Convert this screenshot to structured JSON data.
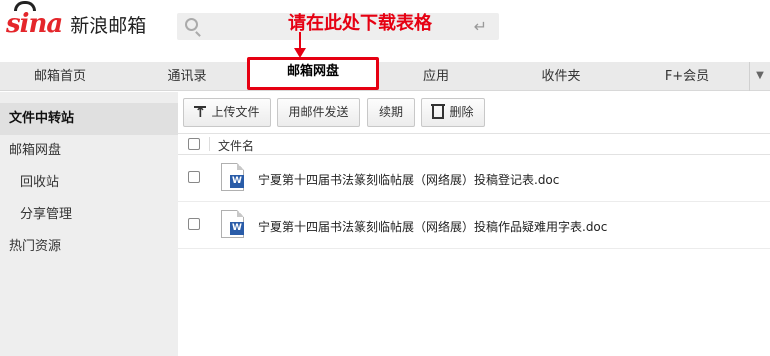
{
  "header": {
    "logo_brand": "sina",
    "logo_text": "新浪邮箱",
    "search_placeholder": "",
    "annotation": "请在此处下载表格"
  },
  "nav": {
    "items": [
      {
        "label": "邮箱首页",
        "active": false
      },
      {
        "label": "通讯录",
        "active": false
      },
      {
        "label": "邮箱网盘",
        "active": true
      },
      {
        "label": "应用",
        "active": false
      },
      {
        "label": "收件夹",
        "active": false
      },
      {
        "label": "F+会员",
        "active": false
      }
    ],
    "more_icon": "chevron-down-icon"
  },
  "sidebar": {
    "items": [
      {
        "label": "文件中转站",
        "active": true
      },
      {
        "label": "邮箱网盘",
        "active": false
      },
      {
        "label": "回收站",
        "active": false
      },
      {
        "label": "分享管理",
        "active": false
      },
      {
        "label": "热门资源",
        "active": false
      }
    ]
  },
  "toolbar": {
    "upload_label": "上传文件",
    "send_label": "用邮件发送",
    "renew_label": "续期",
    "delete_label": "删除"
  },
  "file_list": {
    "column_name": "文件名",
    "files": [
      {
        "name": "宁夏第十四届书法篆刻临帖展（网络展）投稿登记表.doc",
        "type": "word"
      },
      {
        "name": "宁夏第十四届书法篆刻临帖展（网络展）投稿作品疑难用字表.doc",
        "type": "word"
      }
    ]
  },
  "colors": {
    "accent_red": "#e60012",
    "word_blue": "#2a5ca8"
  }
}
